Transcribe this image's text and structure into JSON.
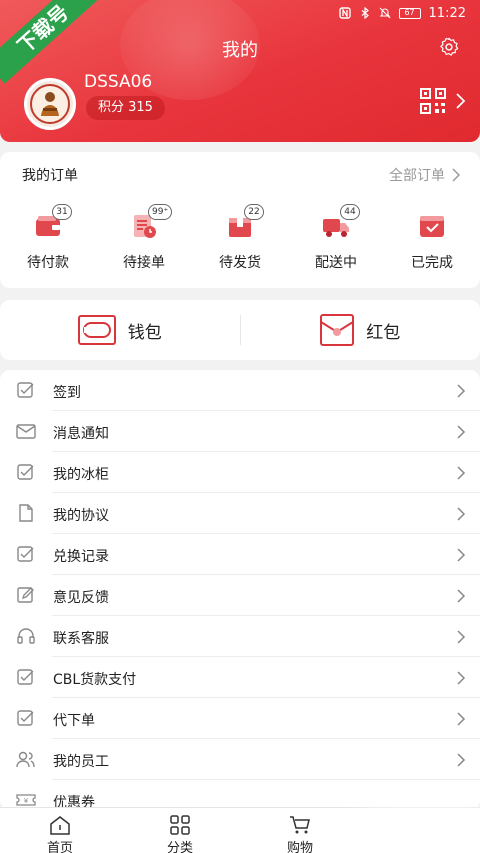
{
  "watermark": {
    "text": "下载号"
  },
  "status_bar": {
    "time": "11:22",
    "battery": "67"
  },
  "header": {
    "title": "我的",
    "username": "DSSA06",
    "points": "积分 315"
  },
  "orders": {
    "title": "我的订单",
    "all_label": "全部订单",
    "items": [
      {
        "label": "待付款",
        "count": "31"
      },
      {
        "label": "待接单",
        "count": "99⁺"
      },
      {
        "label": "待发货",
        "count": "22"
      },
      {
        "label": "配送中",
        "count": "44"
      },
      {
        "label": "已完成",
        "count": ""
      }
    ]
  },
  "wallet": {
    "wallet_label": "钱包",
    "redpacket_label": "红包"
  },
  "menu": {
    "items": [
      {
        "label": "签到",
        "icon": "checkbox-icon"
      },
      {
        "label": "消息通知",
        "icon": "mail-icon"
      },
      {
        "label": "我的冰柜",
        "icon": "checkbox-icon"
      },
      {
        "label": "我的协议",
        "icon": "document-icon"
      },
      {
        "label": "兑换记录",
        "icon": "checkbox-icon"
      },
      {
        "label": "意见反馈",
        "icon": "edit-icon"
      },
      {
        "label": "联系客服",
        "icon": "headset-icon"
      },
      {
        "label": "CBL货款支付",
        "icon": "checkbox-icon"
      },
      {
        "label": "代下单",
        "icon": "checkbox-icon"
      },
      {
        "label": "我的员工",
        "icon": "users-icon"
      },
      {
        "label": "优惠券",
        "icon": "coupon-icon"
      }
    ]
  },
  "tabbar": {
    "home": "首页",
    "category": "分类",
    "cart": "购物"
  },
  "colors": {
    "brand_red": "#e8343c",
    "watermark_green": "#2aa14a"
  }
}
